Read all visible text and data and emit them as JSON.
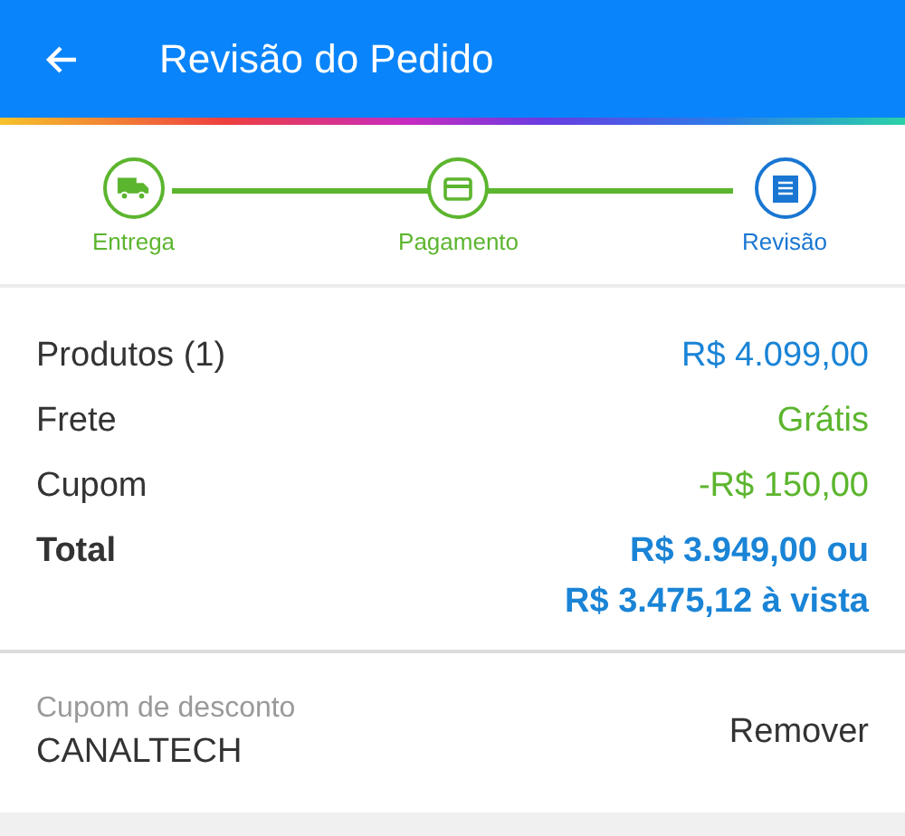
{
  "header": {
    "title": "Revisão do Pedido"
  },
  "steps": [
    {
      "label": "Entrega",
      "selected": false
    },
    {
      "label": "Pagamento",
      "selected": false
    },
    {
      "label": "Revisão",
      "selected": true
    }
  ],
  "summary": [
    {
      "label": "Produtos (1)",
      "kind": "normal",
      "color": "#1a84d6",
      "value": [
        "R$ 4.099,00"
      ]
    },
    {
      "label": "Frete",
      "kind": "normal",
      "color": "#5cb52e",
      "value": [
        "Grátis"
      ]
    },
    {
      "label": "Cupom",
      "kind": "normal",
      "color": "#5cb52e",
      "value": [
        "-R$ 150,00"
      ]
    },
    {
      "label": "Total",
      "kind": "total",
      "color": "#1a84d6",
      "value": [
        "R$ 3.949,00 ou",
        "R$ 3.475,12 à vista"
      ]
    }
  ],
  "coupon": {
    "label": "Cupom de desconto",
    "code": "CANALTECH",
    "action": "Remover"
  }
}
